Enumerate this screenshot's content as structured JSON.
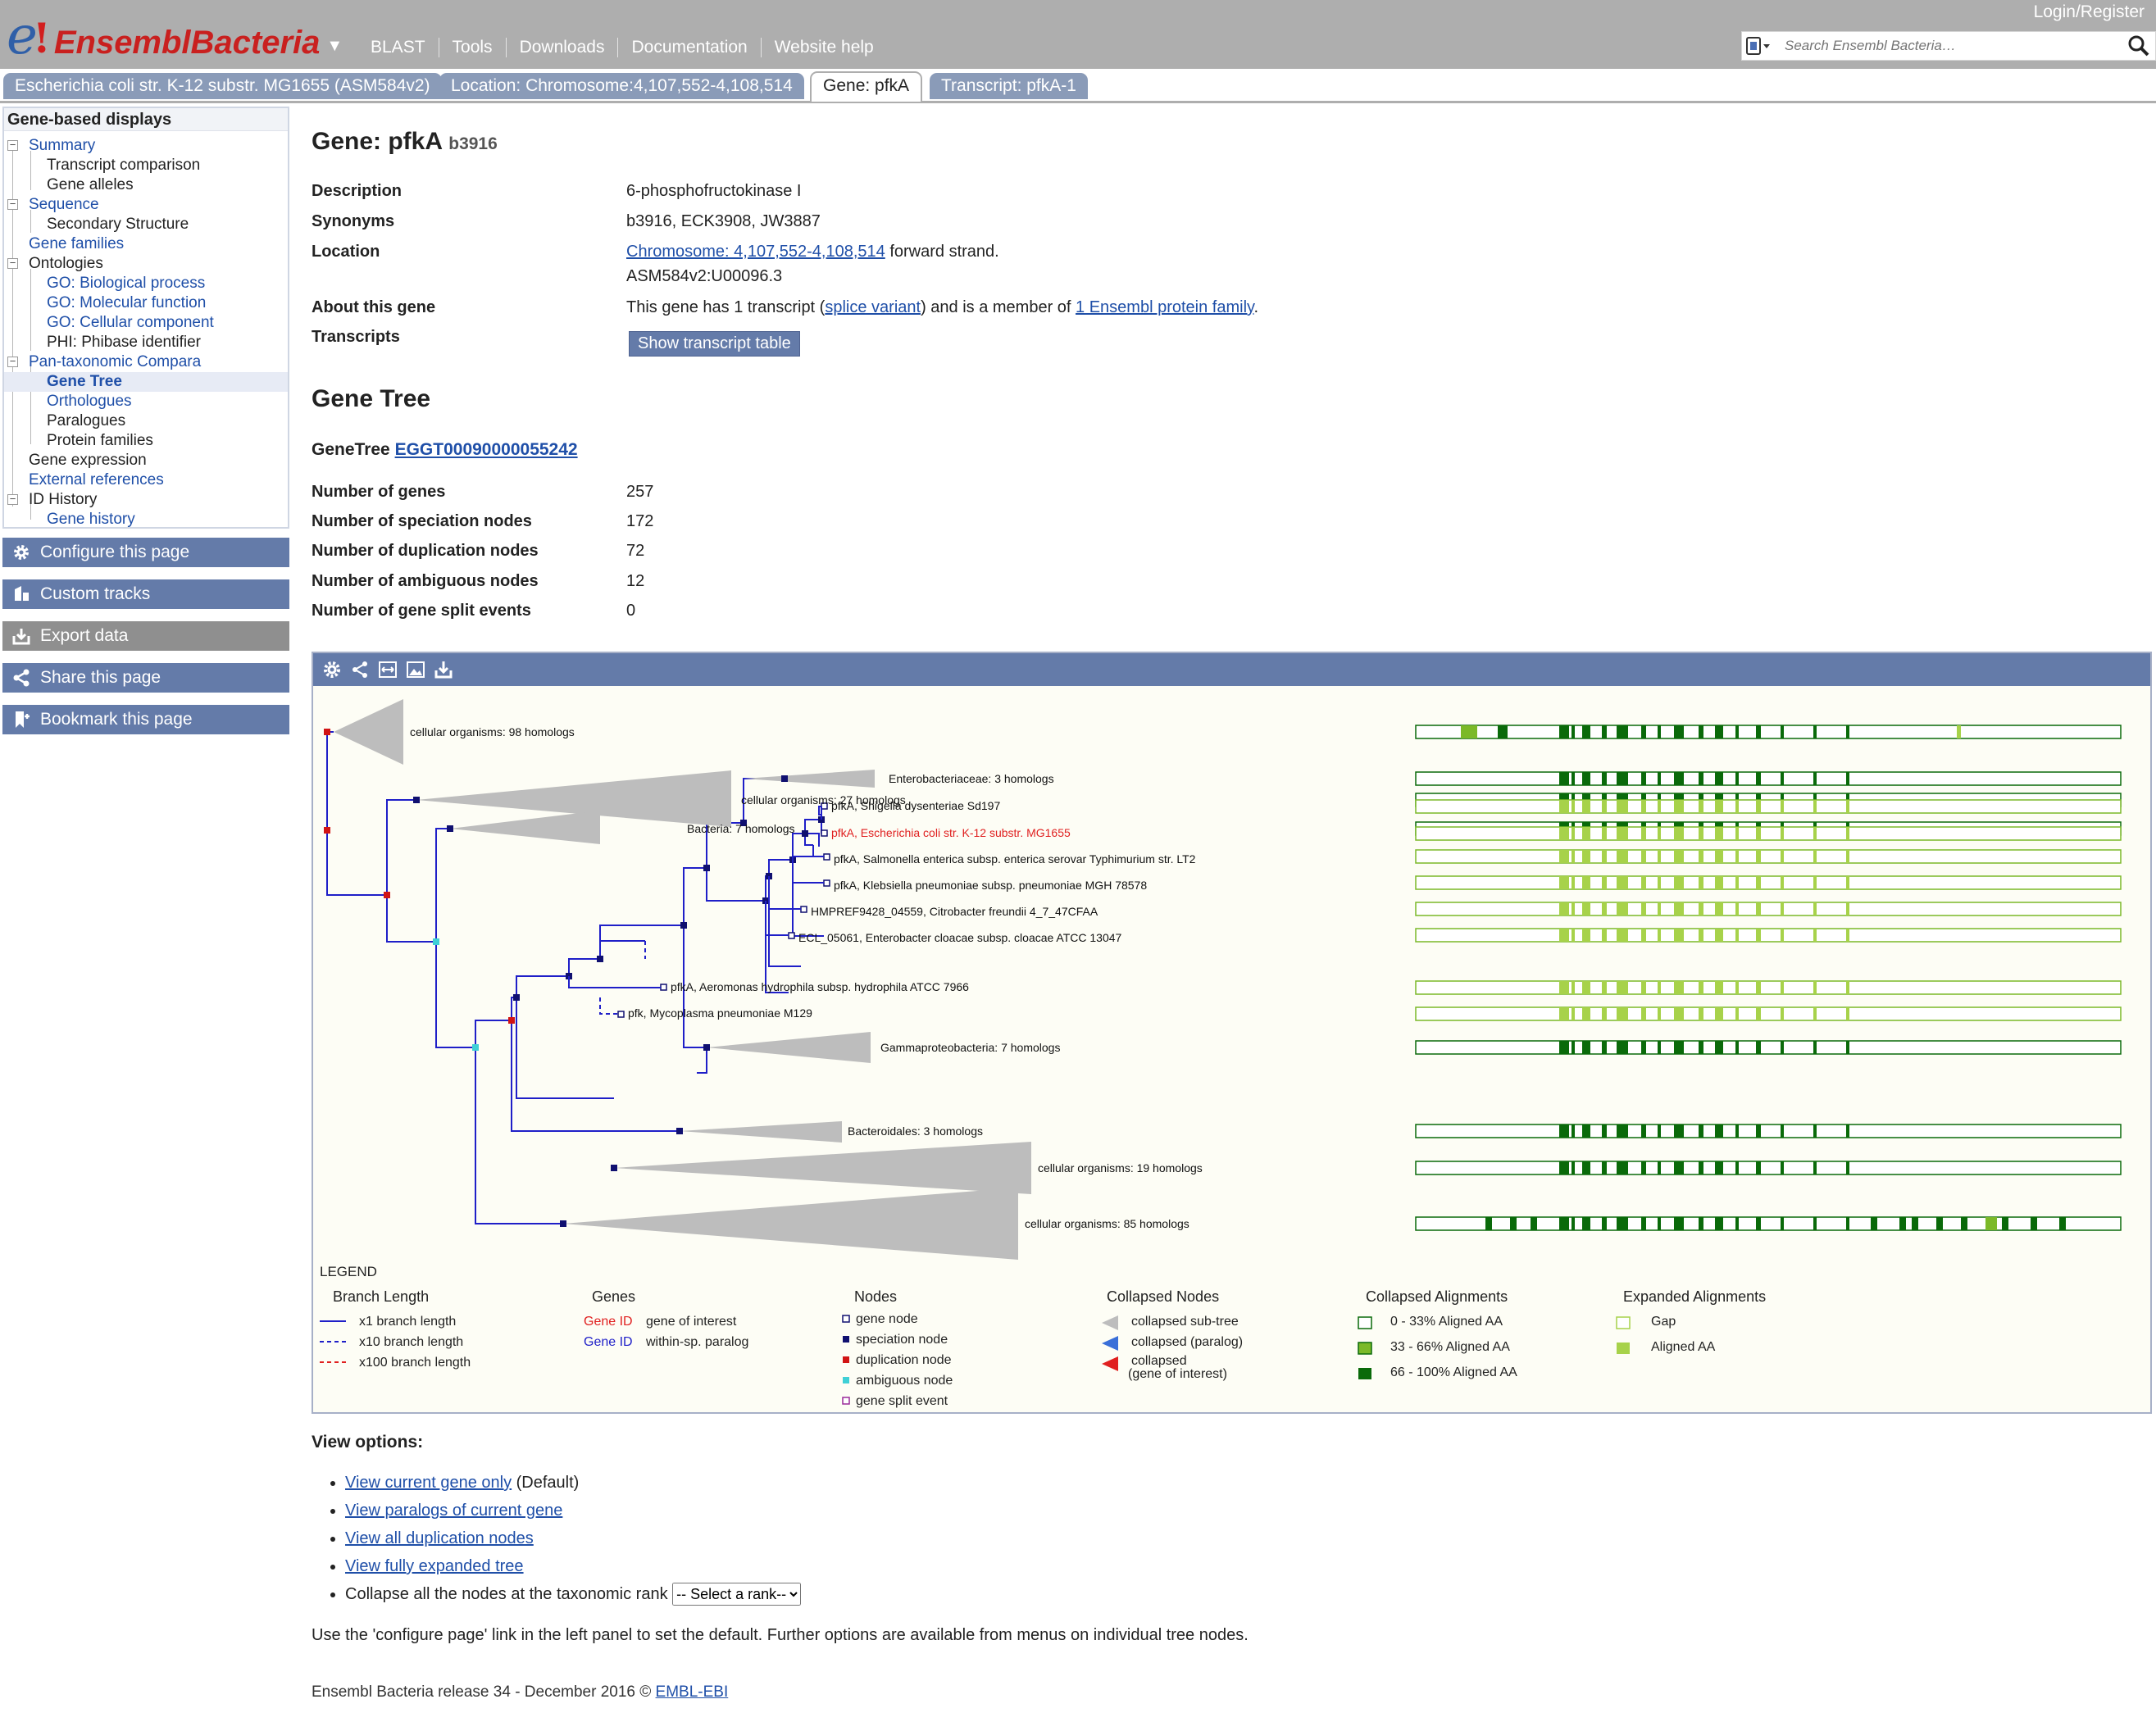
{
  "masthead": {
    "logo_e": "e",
    "logo_bang": "!",
    "logo_text": "EnsemblBacteria",
    "logo_caret": "▼",
    "nav": [
      "BLAST",
      "Tools",
      "Downloads",
      "Documentation",
      "Website help"
    ],
    "login": "Login/Register",
    "search_placeholder": "Search Ensembl Bacteria…"
  },
  "tabs": [
    "Escherichia coli str. K-12 substr. MG1655 (ASM584v2)",
    "Location: Chromosome:4,107,552-4,108,514",
    "Gene: pfkA",
    "Transcript: pfkA-1"
  ],
  "sidebar": {
    "header": "Gene-based displays",
    "items": [
      {
        "label": "Summary",
        "level": 0,
        "link": true
      },
      {
        "label": "Transcript comparison",
        "level": 1,
        "link": false
      },
      {
        "label": "Gene alleles",
        "level": 1,
        "link": false
      },
      {
        "label": "Sequence",
        "level": 0,
        "link": true
      },
      {
        "label": "Secondary Structure",
        "level": 1,
        "link": false
      },
      {
        "label": "Gene families",
        "level": 0,
        "link": true
      },
      {
        "label": "Ontologies",
        "level": 0,
        "link": false
      },
      {
        "label": "GO: Biological process",
        "level": 1,
        "link": true
      },
      {
        "label": "GO: Molecular function",
        "level": 1,
        "link": true
      },
      {
        "label": "GO: Cellular component",
        "level": 1,
        "link": true
      },
      {
        "label": "PHI: Phibase identifier",
        "level": 1,
        "link": false
      },
      {
        "label": "Pan-taxonomic Compara",
        "level": 0,
        "link": true
      },
      {
        "label": "Gene Tree",
        "level": 1,
        "link": true,
        "selected": true
      },
      {
        "label": "Orthologues",
        "level": 1,
        "link": true
      },
      {
        "label": "Paralogues",
        "level": 1,
        "link": false
      },
      {
        "label": "Protein families",
        "level": 1,
        "link": false
      },
      {
        "label": "Gene expression",
        "level": 0,
        "link": false
      },
      {
        "label": "External references",
        "level": 0,
        "link": true
      },
      {
        "label": "ID History",
        "level": 0,
        "link": false
      },
      {
        "label": "Gene history",
        "level": 1,
        "link": true
      }
    ],
    "buttons": [
      "Configure this page",
      "Custom tracks",
      "Export data",
      "Share this page",
      "Bookmark this page"
    ]
  },
  "gene": {
    "title": "Gene: pfkA",
    "stable_id": "b3916",
    "description_label": "Description",
    "description": "6-phosphofructokinase I",
    "synonyms_label": "Synonyms",
    "synonyms": "b3916, ECK3908, JW3887",
    "location_label": "Location",
    "location_link": "Chromosome: 4,107,552-4,108,514",
    "location_strand": "forward strand.",
    "assembly": "ASM584v2:U00096.3",
    "about_label": "About this gene",
    "about_pre": "This gene has 1 transcript (",
    "about_link1": "splice variant",
    "about_mid": ") and is a member of ",
    "about_link2": "1 Ensembl protein family",
    "about_post": ".",
    "transcripts_label": "Transcripts",
    "show_transcript_btn": "Show transcript table"
  },
  "genetree": {
    "heading": "Gene Tree",
    "label": "GeneTree",
    "id": "EGGT00090000055242",
    "stats": [
      {
        "label": "Number of genes",
        "value": "257"
      },
      {
        "label": "Number of speciation nodes",
        "value": "172"
      },
      {
        "label": "Number of duplication nodes",
        "value": "72"
      },
      {
        "label": "Number of ambiguous nodes",
        "value": "12"
      },
      {
        "label": "Number of gene split events",
        "value": "0"
      }
    ]
  },
  "tree_labels": {
    "l1": "cellular organisms: 98 homologs",
    "l2": "cellular organisms: 27 homologs",
    "l3": "Bacteria: 7 homologs",
    "l4": "Enterobacteriaceae: 3 homologs",
    "l5": "pfkA, Shigella dysenteriae Sd197",
    "l6": "pfkA, Escherichia coli str. K-12 substr. MG1655",
    "l7": "pfkA, Salmonella enterica subsp. enterica serovar Typhimurium str. LT2",
    "l8": "pfkA, Klebsiella pneumoniae subsp. pneumoniae MGH 78578",
    "l9": "HMPREF9428_04559, Citrobacter freundii 4_7_47CFAA",
    "l10": "ECL_05061, Enterobacter cloacae subsp. cloacae ATCC 13047",
    "l11": "Gammaproteobacteria: 7 homologs",
    "l12": "pfkA, Aeromonas hydrophila subsp. hydrophila ATCC 7966",
    "l13": "pfk, Mycoplasma pneumoniae M129",
    "l14": "Bacteroidales: 3 homologs",
    "l15": "cellular organisms: 19 homologs",
    "l16": "cellular organisms: 85 homologs"
  },
  "legend": {
    "title": "LEGEND",
    "branch_title": "Branch Length",
    "branch_items": [
      "x1 branch length",
      "x10 branch length",
      "x100 branch length"
    ],
    "genes_title": "Genes",
    "gene_id": "Gene ID",
    "gene_items": [
      "gene of interest",
      "within-sp. paralog"
    ],
    "nodes_title": "Nodes",
    "node_items": [
      "gene node",
      "speciation node",
      "duplication node",
      "ambiguous node",
      "gene split event"
    ],
    "collapsed_title": "Collapsed Nodes",
    "collapsed_items": [
      "collapsed sub-tree",
      "collapsed (paralog)",
      "collapsed",
      "(gene of interest)"
    ],
    "calign_title": "Collapsed Alignments",
    "calign_items": [
      "0 - 33% Aligned AA",
      "33 - 66% Aligned AA",
      "66 - 100% Aligned AA"
    ],
    "ealign_title": "Expanded Alignments",
    "ealign_items": [
      "Gap",
      "Aligned AA"
    ]
  },
  "colors": {
    "tab_bg": "#8a9bb8",
    "button_bg": "#647ba9",
    "tree_line": "#1f1fc8",
    "speciation_node": "#101070",
    "duplication_node": "#d11414",
    "ambiguous_node": "#3fd0d6",
    "gene_of_interest": "#e02020",
    "dark_green": "#0a6a0a",
    "mid_green": "#7bb928",
    "light_green": "#a7d24a"
  },
  "view_options": {
    "title": "View options:",
    "items": [
      {
        "link": "View current gene only",
        "suffix": " (Default)"
      },
      {
        "link": "View paralogs of current gene",
        "suffix": ""
      },
      {
        "link": "View all duplication nodes",
        "suffix": ""
      },
      {
        "link": "View fully expanded tree",
        "suffix": ""
      }
    ],
    "collapse_text": "Collapse all the nodes at the taxonomic rank",
    "select_value": "-- Select a rank--",
    "note": "Use the 'configure page' link in the left panel to set the default. Further options are available from menus on individual tree nodes."
  },
  "footer": {
    "text": "Ensembl Bacteria release 34 - December 2016 © ",
    "link": "EMBL-EBI"
  }
}
